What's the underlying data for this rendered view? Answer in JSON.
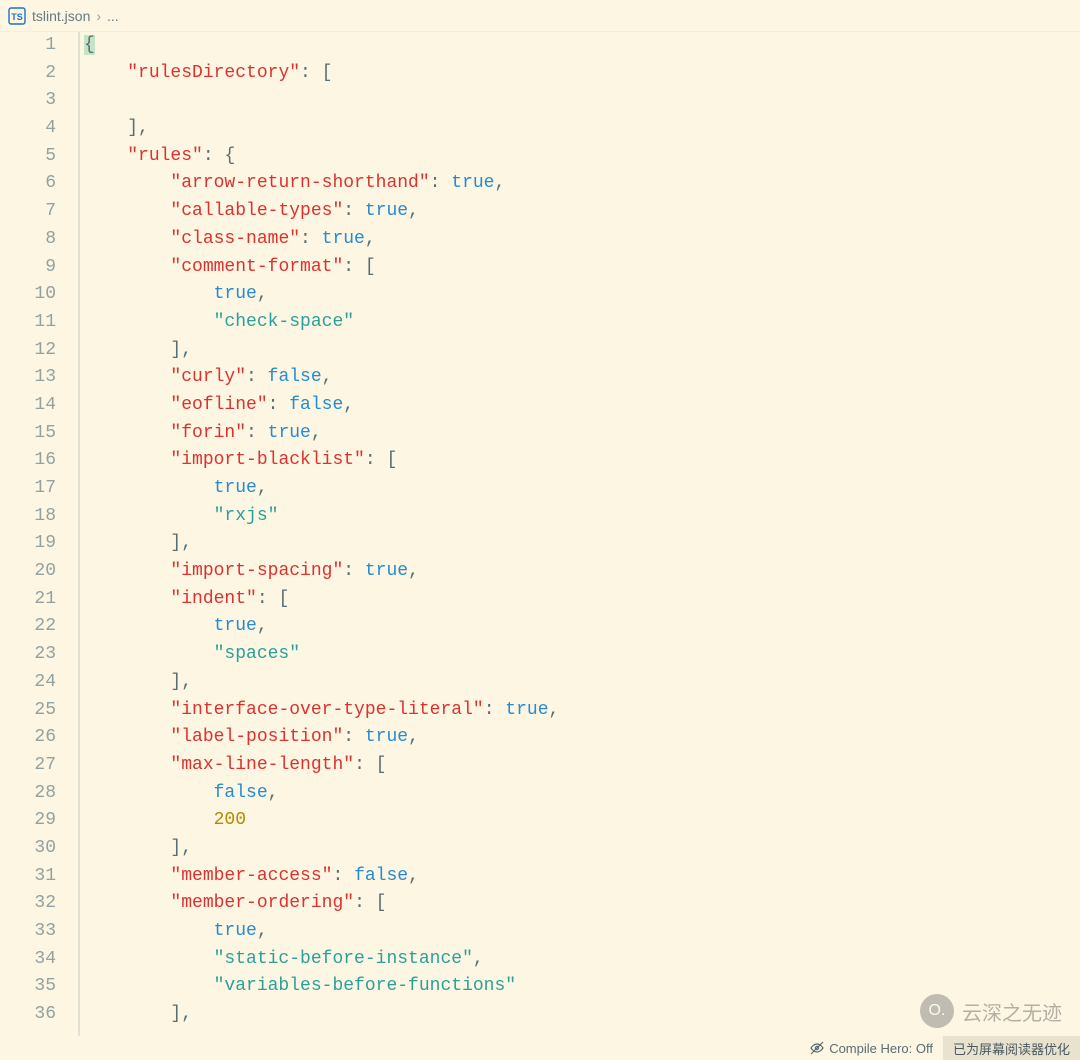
{
  "breadcrumb": {
    "file_icon_label": "TS",
    "file": "tslint.json",
    "sep": "›",
    "tail": "..."
  },
  "lines": [
    {
      "n": "1",
      "tokens": [
        {
          "t": "hl",
          "v": "{"
        }
      ]
    },
    {
      "n": "2",
      "tokens": [
        {
          "t": "p",
          "v": "    "
        },
        {
          "t": "k",
          "v": "\"rulesDirectory\""
        },
        {
          "t": "p",
          "v": ": ["
        }
      ]
    },
    {
      "n": "3",
      "tokens": [
        {
          "t": "p",
          "v": ""
        }
      ]
    },
    {
      "n": "4",
      "tokens": [
        {
          "t": "p",
          "v": "    ],"
        }
      ]
    },
    {
      "n": "5",
      "tokens": [
        {
          "t": "p",
          "v": "    "
        },
        {
          "t": "k",
          "v": "\"rules\""
        },
        {
          "t": "p",
          "v": ": {"
        }
      ]
    },
    {
      "n": "6",
      "tokens": [
        {
          "t": "p",
          "v": "        "
        },
        {
          "t": "k",
          "v": "\"arrow-return-shorthand\""
        },
        {
          "t": "p",
          "v": ": "
        },
        {
          "t": "b",
          "v": "true"
        },
        {
          "t": "p",
          "v": ","
        }
      ]
    },
    {
      "n": "7",
      "tokens": [
        {
          "t": "p",
          "v": "        "
        },
        {
          "t": "k",
          "v": "\"callable-types\""
        },
        {
          "t": "p",
          "v": ": "
        },
        {
          "t": "b",
          "v": "true"
        },
        {
          "t": "p",
          "v": ","
        }
      ]
    },
    {
      "n": "8",
      "tokens": [
        {
          "t": "p",
          "v": "        "
        },
        {
          "t": "k",
          "v": "\"class-name\""
        },
        {
          "t": "p",
          "v": ": "
        },
        {
          "t": "b",
          "v": "true"
        },
        {
          "t": "p",
          "v": ","
        }
      ]
    },
    {
      "n": "9",
      "tokens": [
        {
          "t": "p",
          "v": "        "
        },
        {
          "t": "k",
          "v": "\"comment-format\""
        },
        {
          "t": "p",
          "v": ": ["
        }
      ]
    },
    {
      "n": "10",
      "tokens": [
        {
          "t": "p",
          "v": "            "
        },
        {
          "t": "b",
          "v": "true"
        },
        {
          "t": "p",
          "v": ","
        }
      ]
    },
    {
      "n": "11",
      "tokens": [
        {
          "t": "p",
          "v": "            "
        },
        {
          "t": "s",
          "v": "\"check-space\""
        }
      ]
    },
    {
      "n": "12",
      "tokens": [
        {
          "t": "p",
          "v": "        ],"
        }
      ]
    },
    {
      "n": "13",
      "tokens": [
        {
          "t": "p",
          "v": "        "
        },
        {
          "t": "k",
          "v": "\"curly\""
        },
        {
          "t": "p",
          "v": ": "
        },
        {
          "t": "b",
          "v": "false"
        },
        {
          "t": "p",
          "v": ","
        }
      ]
    },
    {
      "n": "14",
      "tokens": [
        {
          "t": "p",
          "v": "        "
        },
        {
          "t": "k",
          "v": "\"eofline\""
        },
        {
          "t": "p",
          "v": ": "
        },
        {
          "t": "b",
          "v": "false"
        },
        {
          "t": "p",
          "v": ","
        }
      ]
    },
    {
      "n": "15",
      "tokens": [
        {
          "t": "p",
          "v": "        "
        },
        {
          "t": "k",
          "v": "\"forin\""
        },
        {
          "t": "p",
          "v": ": "
        },
        {
          "t": "b",
          "v": "true"
        },
        {
          "t": "p",
          "v": ","
        }
      ]
    },
    {
      "n": "16",
      "tokens": [
        {
          "t": "p",
          "v": "        "
        },
        {
          "t": "k",
          "v": "\"import-blacklist\""
        },
        {
          "t": "p",
          "v": ": ["
        }
      ]
    },
    {
      "n": "17",
      "tokens": [
        {
          "t": "p",
          "v": "            "
        },
        {
          "t": "b",
          "v": "true"
        },
        {
          "t": "p",
          "v": ","
        }
      ]
    },
    {
      "n": "18",
      "tokens": [
        {
          "t": "p",
          "v": "            "
        },
        {
          "t": "s",
          "v": "\"rxjs\""
        }
      ]
    },
    {
      "n": "19",
      "tokens": [
        {
          "t": "p",
          "v": "        ],"
        }
      ]
    },
    {
      "n": "20",
      "tokens": [
        {
          "t": "p",
          "v": "        "
        },
        {
          "t": "k",
          "v": "\"import-spacing\""
        },
        {
          "t": "p",
          "v": ": "
        },
        {
          "t": "b",
          "v": "true"
        },
        {
          "t": "p",
          "v": ","
        }
      ]
    },
    {
      "n": "21",
      "tokens": [
        {
          "t": "p",
          "v": "        "
        },
        {
          "t": "k",
          "v": "\"indent\""
        },
        {
          "t": "p",
          "v": ": ["
        }
      ]
    },
    {
      "n": "22",
      "tokens": [
        {
          "t": "p",
          "v": "            "
        },
        {
          "t": "b",
          "v": "true"
        },
        {
          "t": "p",
          "v": ","
        }
      ]
    },
    {
      "n": "23",
      "tokens": [
        {
          "t": "p",
          "v": "            "
        },
        {
          "t": "s",
          "v": "\"spaces\""
        }
      ]
    },
    {
      "n": "24",
      "tokens": [
        {
          "t": "p",
          "v": "        ],"
        }
      ]
    },
    {
      "n": "25",
      "tokens": [
        {
          "t": "p",
          "v": "        "
        },
        {
          "t": "k",
          "v": "\"interface-over-type-literal\""
        },
        {
          "t": "p",
          "v": ": "
        },
        {
          "t": "b",
          "v": "true"
        },
        {
          "t": "p",
          "v": ","
        }
      ]
    },
    {
      "n": "26",
      "tokens": [
        {
          "t": "p",
          "v": "        "
        },
        {
          "t": "k",
          "v": "\"label-position\""
        },
        {
          "t": "p",
          "v": ": "
        },
        {
          "t": "b",
          "v": "true"
        },
        {
          "t": "p",
          "v": ","
        }
      ]
    },
    {
      "n": "27",
      "tokens": [
        {
          "t": "p",
          "v": "        "
        },
        {
          "t": "k",
          "v": "\"max-line-length\""
        },
        {
          "t": "p",
          "v": ": ["
        }
      ]
    },
    {
      "n": "28",
      "tokens": [
        {
          "t": "p",
          "v": "            "
        },
        {
          "t": "b",
          "v": "false"
        },
        {
          "t": "p",
          "v": ","
        }
      ]
    },
    {
      "n": "29",
      "tokens": [
        {
          "t": "p",
          "v": "            "
        },
        {
          "t": "n",
          "v": "200"
        }
      ]
    },
    {
      "n": "30",
      "tokens": [
        {
          "t": "p",
          "v": "        ],"
        }
      ]
    },
    {
      "n": "31",
      "tokens": [
        {
          "t": "p",
          "v": "        "
        },
        {
          "t": "k",
          "v": "\"member-access\""
        },
        {
          "t": "p",
          "v": ": "
        },
        {
          "t": "b",
          "v": "false"
        },
        {
          "t": "p",
          "v": ","
        }
      ]
    },
    {
      "n": "32",
      "tokens": [
        {
          "t": "p",
          "v": "        "
        },
        {
          "t": "k",
          "v": "\"member-ordering\""
        },
        {
          "t": "p",
          "v": ": ["
        }
      ]
    },
    {
      "n": "33",
      "tokens": [
        {
          "t": "p",
          "v": "            "
        },
        {
          "t": "b",
          "v": "true"
        },
        {
          "t": "p",
          "v": ","
        }
      ]
    },
    {
      "n": "34",
      "tokens": [
        {
          "t": "p",
          "v": "            "
        },
        {
          "t": "s",
          "v": "\"static-before-instance\""
        },
        {
          "t": "p",
          "v": ","
        }
      ]
    },
    {
      "n": "35",
      "tokens": [
        {
          "t": "p",
          "v": "            "
        },
        {
          "t": "s",
          "v": "\"variables-before-functions\""
        }
      ]
    },
    {
      "n": "36",
      "tokens": [
        {
          "t": "p",
          "v": "        ],"
        }
      ]
    }
  ],
  "status": {
    "compile_hero": "Compile Hero: Off",
    "reader": "已为屏幕阅读器优化"
  },
  "watermark": {
    "icon_text": "O.",
    "text": "云深之无迹"
  }
}
